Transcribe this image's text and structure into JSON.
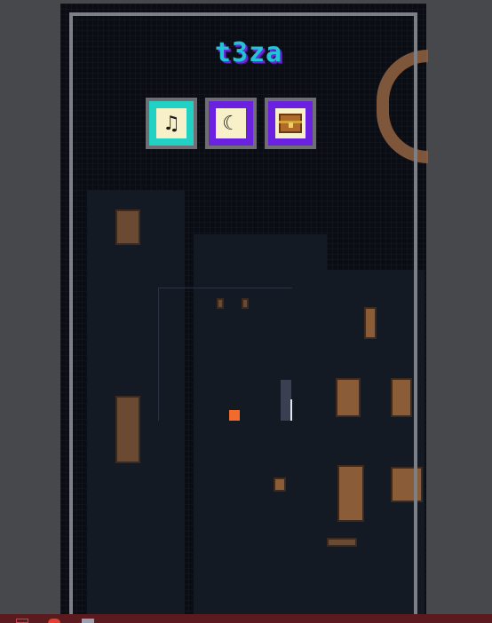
{
  "game": {
    "title": "t3za",
    "buttons": [
      {
        "name": "music-toggle",
        "icon": "music-muted-icon",
        "glyph": "♫"
      },
      {
        "name": "night-mode",
        "icon": "moon-icon",
        "glyph": "☾"
      },
      {
        "name": "treasure",
        "icon": "treasure-chest-icon"
      }
    ]
  },
  "colors": {
    "title": "#22c4d8",
    "title_shadow": "#6a2ad8",
    "music_button": "#21d2c4",
    "night_button": "#6a22e0",
    "chest_button": "#6a22e0",
    "ball": "#f26b2a",
    "taskbar": "#5a1a1e"
  }
}
